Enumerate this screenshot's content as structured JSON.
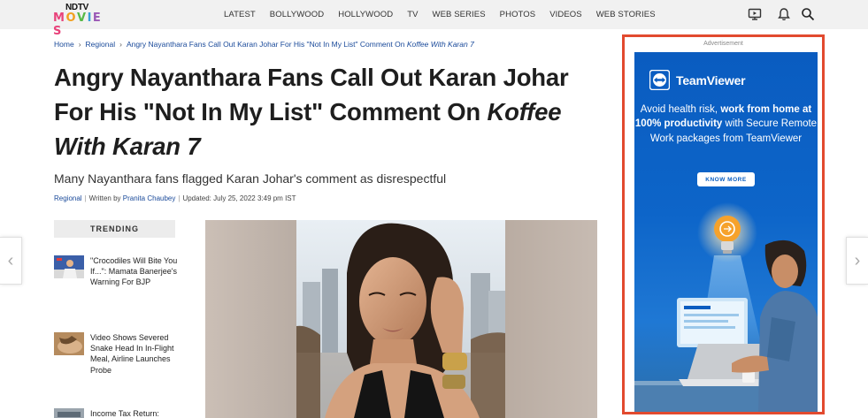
{
  "header": {
    "logo_top": "NDTV",
    "logo_bottom": "MOVIES",
    "nav": [
      "LATEST",
      "BOLLYWOOD",
      "HOLLYWOOD",
      "TV",
      "WEB SERIES",
      "PHOTOS",
      "VIDEOS",
      "WEB STORIES"
    ],
    "icons": [
      "tv-live-icon",
      "bell-icon",
      "search-icon"
    ]
  },
  "breadcrumb": {
    "home": "Home",
    "section": "Regional",
    "current_prefix": "Angry Nayanthara Fans Call Out Karan Johar For His \"Not In My List\" Comment On ",
    "current_em": "Koffee With Karan 7"
  },
  "article": {
    "title_plain": "Angry Nayanthara Fans Call Out Karan Johar For His \"Not In My List\" Comment On ",
    "title_em": "Koffee With Karan 7",
    "subtitle": "Many Nayanthara fans flagged Karan Johar's comment as disrespectful",
    "category": "Regional",
    "written_by_label": "Written by",
    "author": "Pranita Chaubey",
    "updated": "Updated: July 25, 2022 3:49 pm IST"
  },
  "trending": {
    "heading": "TRENDING",
    "items": [
      {
        "title": "\"Crocodiles Will Bite You If...\": Mamata Banerjee's Warning For BJP"
      },
      {
        "title": "Video Shows Severed Snake Head In In-Flight Meal, Airline Launches Probe"
      },
      {
        "title": "Income Tax Return:"
      }
    ]
  },
  "ad": {
    "label": "Advertisement",
    "brand": "TeamViewer",
    "line1": "Avoid health risk, ",
    "line1_bold": "work from home at 100% productivity",
    "line2": " with Secure Remote Work packages from TeamViewer",
    "cta": "KNOW MORE"
  },
  "colors": {
    "link": "#1a4a9a",
    "ad_border": "#e24a2f",
    "ad_blue": "#0b5fc2",
    "header_bg": "#f1f1f1"
  }
}
